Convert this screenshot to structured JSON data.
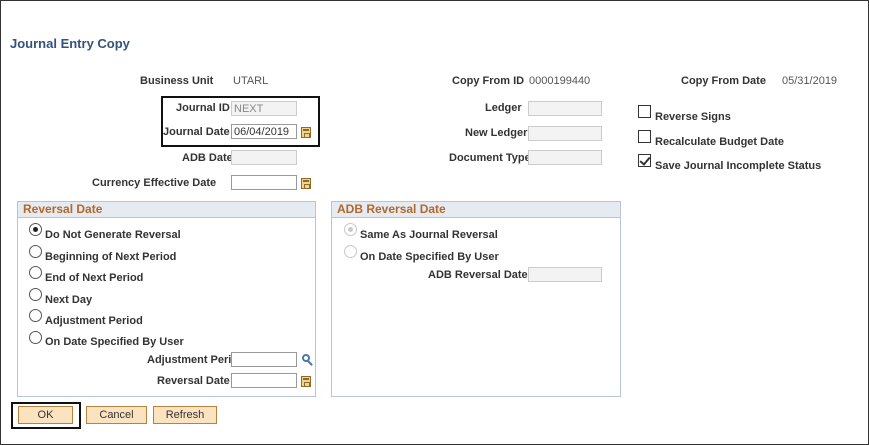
{
  "page": {
    "title": "Journal Entry Copy"
  },
  "header": {
    "business_unit_label": "Business Unit",
    "business_unit_value": "UTARL",
    "copy_from_id_label": "Copy From ID",
    "copy_from_id_value": "0000199440",
    "copy_from_date_label": "Copy From Date",
    "copy_from_date_value": "05/31/2019"
  },
  "fields": {
    "journal_id_label": "Journal ID",
    "journal_id_value": "NEXT",
    "journal_date_label": "Journal Date",
    "journal_date_value": "06/04/2019",
    "adb_date_label": "ADB Date",
    "adb_date_value": "",
    "currency_effective_date_label": "Currency Effective Date",
    "currency_effective_date_value": "",
    "ledger_label": "Ledger",
    "ledger_value": "",
    "new_ledger_label": "New Ledger",
    "new_ledger_value": "",
    "document_type_label": "Document Type",
    "document_type_value": ""
  },
  "checkboxes": {
    "reverse_signs": {
      "label": "Reverse Signs",
      "checked": false
    },
    "recalculate_budget_date": {
      "label": "Recalculate Budget Date",
      "checked": false
    },
    "save_journal_incomplete_status": {
      "label": "Save Journal Incomplete Status",
      "checked": true
    }
  },
  "reversal_date": {
    "title": "Reversal Date",
    "options": [
      {
        "label": "Do Not Generate Reversal",
        "selected": true
      },
      {
        "label": "Beginning of Next Period",
        "selected": false
      },
      {
        "label": "End of Next Period",
        "selected": false
      },
      {
        "label": "Next Day",
        "selected": false
      },
      {
        "label": "Adjustment Period",
        "selected": false
      },
      {
        "label": "On Date Specified By User",
        "selected": false
      }
    ],
    "adjustment_period_label": "Adjustment Period",
    "adjustment_period_value": "",
    "reversal_date_label": "Reversal Date",
    "reversal_date_value": ""
  },
  "adb_reversal_date": {
    "title": "ADB Reversal Date",
    "options": [
      {
        "label": "Same As Journal Reversal",
        "selected": true,
        "disabled": true
      },
      {
        "label": "On Date Specified By User",
        "selected": false,
        "disabled": true
      }
    ],
    "adb_reversal_date_label": "ADB Reversal Date",
    "adb_reversal_date_value": ""
  },
  "buttons": {
    "ok": "OK",
    "cancel": "Cancel",
    "refresh": "Refresh"
  },
  "icons": {
    "calendar": "calendar-icon",
    "lookup": "magnifier-icon",
    "check": "checkmark-icon"
  },
  "colors": {
    "title": "#33537d",
    "group_title": "#b3682b",
    "button_bg": "#fbe3c0",
    "group_header_bg": "#e6ebf1"
  }
}
